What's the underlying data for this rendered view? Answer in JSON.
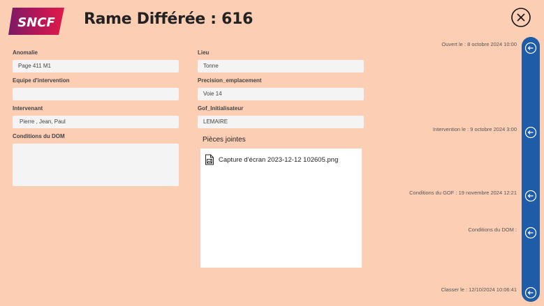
{
  "header": {
    "logo_text": "SNCF",
    "title": "Rame Différée : 616",
    "close_icon": "close-circle-icon"
  },
  "form": {
    "anomalie": {
      "label": "Anomalie",
      "value": "Page 411 M1"
    },
    "equipe": {
      "label": "Equipe d'intervention",
      "value": ""
    },
    "intervenant": {
      "label": "Intervenant",
      "value": "Pierre , Jean, Paul"
    },
    "conditions_dom": {
      "label": "Conditions du DOM",
      "value": ""
    },
    "lieu": {
      "label": "Lieu",
      "value": "Tonne"
    },
    "precision": {
      "label": "Precision_emplacement",
      "value": "Voie 14"
    },
    "gof": {
      "label": "Gof_Initialisateur",
      "value": "LEMAIRE"
    }
  },
  "attachments": {
    "label": "Pièces jointes",
    "items": [
      {
        "name": "Capture d'écran 2023-12-12 102605.png",
        "icon": "image-file-icon"
      }
    ]
  },
  "timeline": {
    "accent_color": "#1f5ca8",
    "events": [
      {
        "label": "Ouvert le : 8 octobre 2024 10:00",
        "icon": "arrow-left-circle-icon"
      },
      {
        "label": "Intervention le : 9 octobre 2024 3:00",
        "icon": "arrow-left-circle-icon"
      },
      {
        "label": "Conditions du GOF : 19 novembre 2024 12:21",
        "icon": "arrow-left-circle-icon"
      },
      {
        "label": "Conditions du DOM :",
        "icon": "arrow-left-circle-icon"
      },
      {
        "label": "Classer le : 12/10/2024 10:06:41",
        "icon": "arrow-left-circle-icon"
      }
    ]
  },
  "colors": {
    "background": "#fcceb4",
    "input_bg": "#f4f4f4",
    "logo_gradient": [
      "#8e1a5c",
      "#d9174d"
    ]
  }
}
